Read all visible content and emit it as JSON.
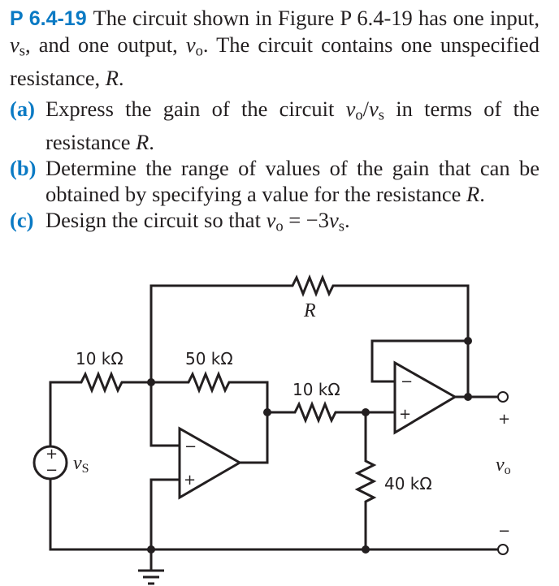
{
  "problem": {
    "id": "P 6.4-19",
    "intro_1": "The circuit shown in Figure P 6.4-19 has one input,",
    "intro_var_in": "v",
    "intro_var_in_sub": "s",
    "intro_2": ", and one output, ",
    "intro_var_out": "v",
    "intro_var_out_sub": "o",
    "intro_3": ". The circuit contains one unspecified resistance, ",
    "intro_var_R": "R",
    "intro_4": "."
  },
  "parts": [
    {
      "label": "(a)",
      "text_1": "Express the gain of the circuit ",
      "v1": "v",
      "v1_sub": "o",
      "slash": "/",
      "v2": "v",
      "v2_sub": "s",
      "text_2": " in terms of the resistance ",
      "R": "R",
      "text_3": "."
    },
    {
      "label": "(b)",
      "text_1": "Determine the range of values of the gain that can be obtained by specifying a value for the resistance ",
      "R": "R",
      "text_2": "."
    },
    {
      "label": "(c)",
      "text_1": "Design the circuit so that ",
      "v1": "v",
      "v1_sub": "o",
      "eq": " = −3",
      "v2": "v",
      "v2_sub": "s",
      "text_2": "."
    }
  ],
  "circuit": {
    "components": {
      "r_input": "10 kΩ",
      "r_feedback_1": "50 kΩ",
      "r_variable": "R",
      "r_series": "10 kΩ",
      "r_shunt": "40 kΩ"
    },
    "source": {
      "label": "v",
      "label_sub": "S",
      "plus": "+",
      "minus": "−"
    },
    "output": {
      "label": "v",
      "label_sub": "o",
      "plus": "+",
      "minus": "−"
    },
    "opamp_1": {
      "inv": "−",
      "noninv": "+"
    },
    "opamp_2": {
      "inv": "−",
      "noninv": "+"
    }
  },
  "colors": {
    "accent": "#0a7ac4",
    "ink": "#231f20"
  }
}
